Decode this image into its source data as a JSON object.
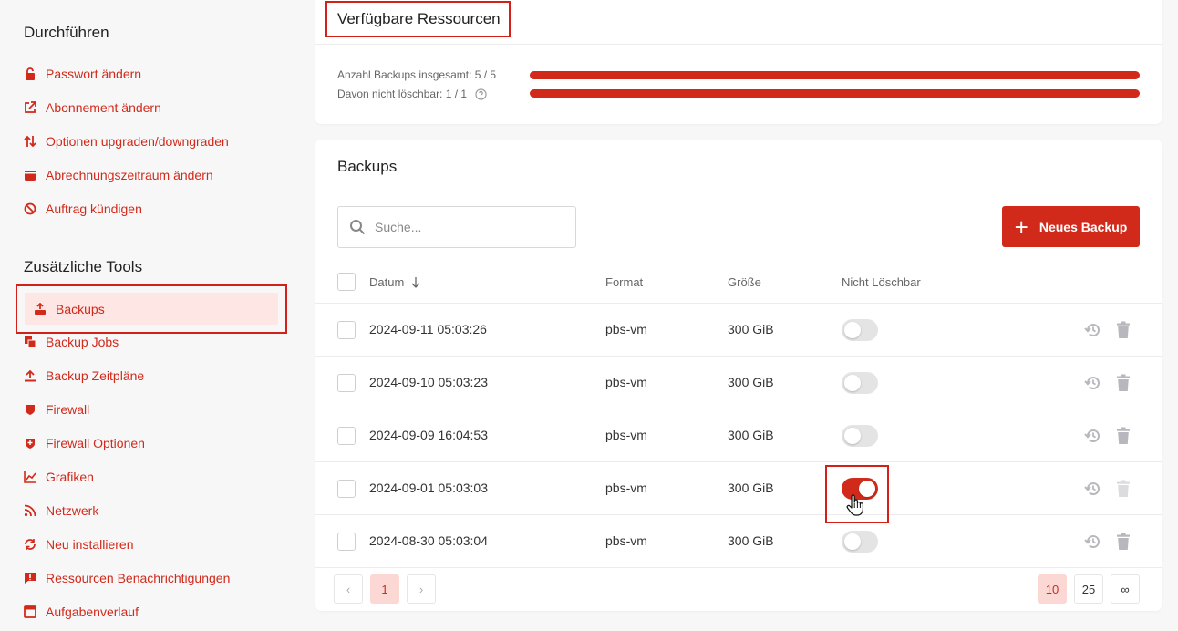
{
  "sidebar": {
    "section_perform": "Durchführen",
    "perform_items": [
      {
        "label": "Passwort ändern",
        "icon": "lock-icon"
      },
      {
        "label": "Abonnement ändern",
        "icon": "external-link-icon"
      },
      {
        "label": "Optionen upgraden/downgraden",
        "icon": "sort-arrows-icon"
      },
      {
        "label": "Abrechnungszeitraum ändern",
        "icon": "wallet-icon"
      },
      {
        "label": "Auftrag kündigen",
        "icon": "ban-icon"
      }
    ],
    "section_tools": "Zusätzliche Tools",
    "active_item": {
      "label": "Backups",
      "icon": "backup-icon"
    },
    "tool_items": [
      {
        "label": "Backup Jobs",
        "icon": "copy-icon"
      },
      {
        "label": "Backup Zeitpläne",
        "icon": "upload-icon"
      },
      {
        "label": "Firewall",
        "icon": "shield-icon"
      },
      {
        "label": "Firewall Optionen",
        "icon": "shield-plus-icon"
      },
      {
        "label": "Grafiken",
        "icon": "chart-line-icon"
      },
      {
        "label": "Netzwerk",
        "icon": "rss-icon"
      },
      {
        "label": "Neu installieren",
        "icon": "sync-icon"
      },
      {
        "label": "Ressourcen Benachrichtigungen",
        "icon": "alert-message-icon"
      },
      {
        "label": "Aufgabenverlauf",
        "icon": "window-icon"
      }
    ]
  },
  "resources": {
    "title": "Verfügbare Ressourcen",
    "total_label": "Anzahl Backups insgesamt: 5 / 5",
    "total_fraction": 1.0,
    "nondeletable_label": "Davon nicht löschbar: 1 / 1",
    "nondeletable_fraction": 1.0
  },
  "backups": {
    "title": "Backups",
    "search_placeholder": "Suche...",
    "new_button": "Neues Backup",
    "columns": {
      "date": "Datum",
      "format": "Format",
      "size": "Größe",
      "not_deletable": "Nicht Löschbar"
    },
    "rows": [
      {
        "date": "2024-09-11 05:03:26",
        "format": "pbs-vm",
        "size": "300 GiB",
        "locked": false
      },
      {
        "date": "2024-09-10 05:03:23",
        "format": "pbs-vm",
        "size": "300 GiB",
        "locked": false
      },
      {
        "date": "2024-09-09 16:04:53",
        "format": "pbs-vm",
        "size": "300 GiB",
        "locked": false
      },
      {
        "date": "2024-09-01 05:03:03",
        "format": "pbs-vm",
        "size": "300 GiB",
        "locked": true
      },
      {
        "date": "2024-08-30 05:03:04",
        "format": "pbs-vm",
        "size": "300 GiB",
        "locked": false
      }
    ]
  },
  "pagination": {
    "prev": "‹",
    "current_page": "1",
    "next": "›",
    "page_sizes": [
      "10",
      "25",
      "∞"
    ],
    "selected_page_size": "10"
  },
  "colors": {
    "accent": "#d12a1b",
    "highlight": "#d32019",
    "active_bg": "#fde6e4"
  }
}
